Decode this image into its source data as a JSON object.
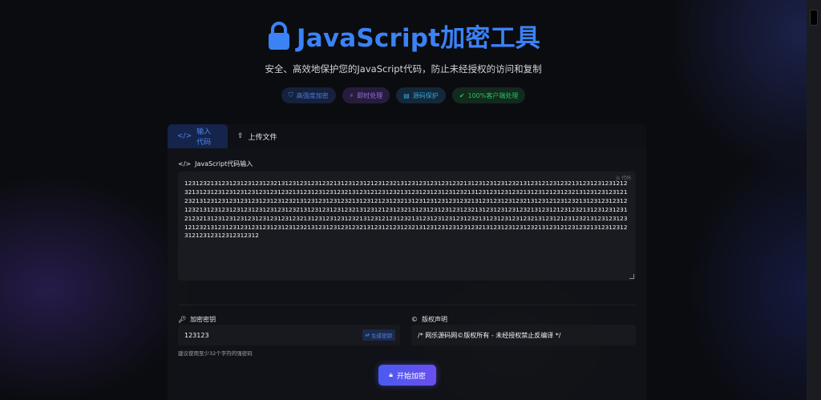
{
  "header": {
    "title": "JavaScript加密工具",
    "subtitle": "安全、高效地保护您的JavaScript代码，防止未经授权的访问和复制",
    "badges": [
      {
        "label": "高强度加密",
        "icon": "shield-icon"
      },
      {
        "label": "即时处理",
        "icon": "bolt-icon"
      },
      {
        "label": "源码保护",
        "icon": "file-code-icon"
      },
      {
        "label": "100%客户端处理",
        "icon": "check-circle-icon"
      }
    ]
  },
  "tabs": [
    {
      "label": "输入代码",
      "icon": "code-icon"
    },
    {
      "label": "上传文件",
      "icon": "upload-icon"
    }
  ],
  "code_section": {
    "label": "JavaScript代码输入",
    "value": "12312321312312312312312321312312312312321312312312123123213123123123123123213123123123123213123121231232131231231231212321312312312312312312312312321312312312312321312312123123213123123123123123213123123123123213123121231232131231231231212321312312312312312312312312321312312312312321312312123123213123123123123123213123123123123213123121231232131231231231212321312312312312312312312312321312312312312321312312123123213123123123123123213123123123123213123121231232131231231231212321312312312312312312312312321312312312312321312312123123213123123123123123213123123123123213123121231232131231231231212321312312312312312312312312321312312312312321312312123123213123123123123123213123123123123213123121231232131231231231212312312312312312",
    "corner_label": "js 代码"
  },
  "key_section": {
    "label": "加密密钥",
    "value": "123123",
    "generate_label": "生成密钥",
    "hint": "建议使用至少32个字符的强密码"
  },
  "copyright_section": {
    "label": "版权声明",
    "value": "/* 网乐源码网©版权所有 - 未经授权禁止反编译 */"
  },
  "encrypt_button": "开始加密",
  "colors": {
    "accent": "#3b82f6",
    "button_gradient_start": "#4a5bf0",
    "button_gradient_end": "#6a4ff0"
  }
}
